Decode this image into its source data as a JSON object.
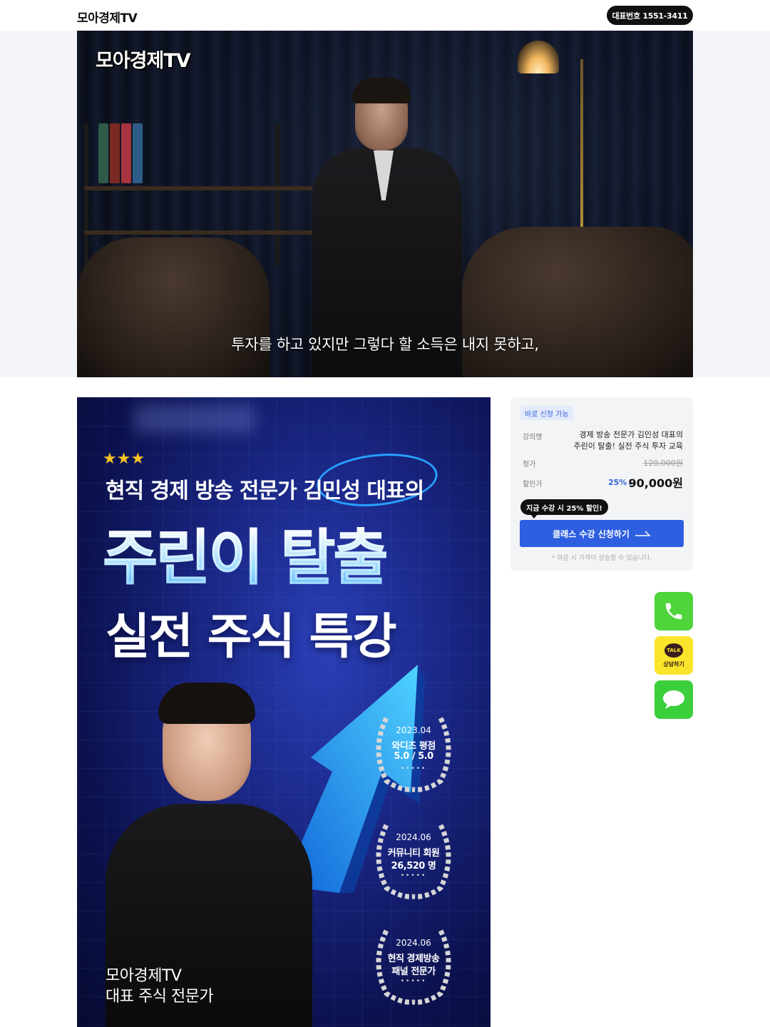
{
  "header": {
    "logo": "모아경제TV",
    "phone_label": "대표번호 1551-3411"
  },
  "video": {
    "watermark": "모아경제TV",
    "subtitle": "투자를 하고 있지만 그렇다 할 소득은 내지 못하고,"
  },
  "poster": {
    "stars": "★★★",
    "subheading": "현직 경제 방송 전문가 김민성 대표의",
    "title_line1": "주린이 탈출",
    "title_line2": "실전 주식 특강",
    "name_line1": "모아경제TV",
    "name_line2": "대표 주식 전문가",
    "awards": [
      {
        "date": "2023.04",
        "line1": "와디즈 평점",
        "line2": "5.0 / 5.0",
        "dots": "•••••"
      },
      {
        "date": "2024.06",
        "line1": "커뮤니티 회원",
        "line2": "26,520 명",
        "dots": "•••••"
      },
      {
        "date": "2024.06",
        "line1": "현직 경제방송",
        "line2": "패널 전문가",
        "dots": "•••••"
      }
    ]
  },
  "panel": {
    "badge": "바로 신청 가능",
    "course_label": "강의명",
    "course_name_line1": "경제 방송 전문가 김민성 대표의",
    "course_name_line2": "주린이 탈출! 실전 주식 투자 교육",
    "price_label": "정가",
    "price_original": "120,000원",
    "sale_label": "할인가",
    "discount": "25%↓",
    "price_sale": "90,000원",
    "tooltip": "지금 수강 시 25% 할인!",
    "cta_label": "클래스 수강 신청하기",
    "note": "* 마감 시 가격이 상승할 수 있습니다."
  },
  "floating": {
    "kakao_talk": "TALK",
    "kakao_label": "상담하기"
  },
  "colors": {
    "accent_blue": "#2e5fe0",
    "phone_green": "#4fd43a",
    "kakao_yellow": "#fbe52a",
    "message_green": "#3ccf3c"
  }
}
